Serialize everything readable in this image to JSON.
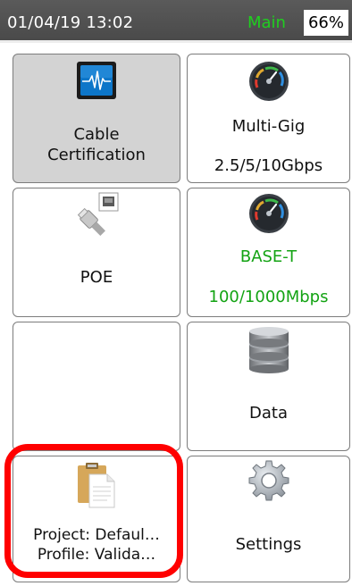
{
  "status_bar": {
    "datetime": "01/04/19 13:02",
    "mode": "Main",
    "battery": "66%"
  },
  "tiles": {
    "cable_certification": {
      "line1": "Cable",
      "line2": "Certification"
    },
    "multi_gig": {
      "title": "Multi-Gig",
      "speed": "2.5/5/10Gbps"
    },
    "poe": {
      "title": "POE"
    },
    "base_t": {
      "title": "BASE-T",
      "speed": "100/1000Mbps"
    },
    "data": {
      "title": "Data"
    },
    "project_profile": {
      "project": "Project: Defaul…",
      "profile": "Profile: Valida…"
    },
    "settings": {
      "title": "Settings"
    }
  },
  "colors": {
    "status_green": "#1fcf1f",
    "text_green": "#13a313",
    "highlight_red": "#ff0000",
    "selected_tile": "#d3d3d3"
  }
}
